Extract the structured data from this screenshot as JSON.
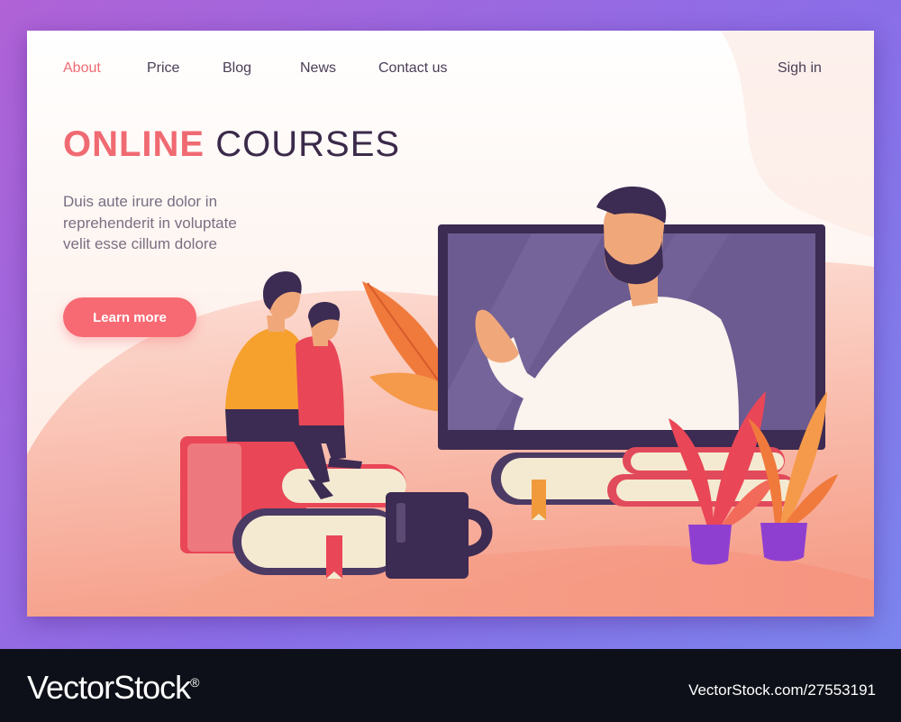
{
  "nav": {
    "items": [
      {
        "label": "About",
        "active": true
      },
      {
        "label": "Price",
        "active": false
      },
      {
        "label": "Blog",
        "active": false
      },
      {
        "label": "News",
        "active": false
      },
      {
        "label": "Contact us",
        "active": false
      }
    ],
    "signin": "Sigh in"
  },
  "hero": {
    "title_accent": "ONLINE",
    "title_rest": "COURSES",
    "lines": [
      "Duis aute irure dolor in",
      "reprehenderit in voluptate",
      "velit esse cillum dolore"
    ],
    "cta": "Learn more"
  },
  "footer": {
    "brand": "VectorStock",
    "brand_mark": "®",
    "stock_id": "VectorStock.com/27553191"
  },
  "colors": {
    "accent": "#f06a72",
    "button": "#f76a73",
    "heading_dark": "#3b2a4a",
    "body_text": "#7a6e82",
    "monitor_frame": "#3c2b52",
    "monitor_screen": "#6c5b91",
    "pot_purple": "#8f3fd0",
    "background": "#9c68e2"
  },
  "illustration": {
    "icons": [
      "monitor-icon",
      "teacher-icon",
      "parent-icon",
      "child-icon",
      "books-icon",
      "mug-icon",
      "plant-icon",
      "leaves-icon"
    ]
  }
}
